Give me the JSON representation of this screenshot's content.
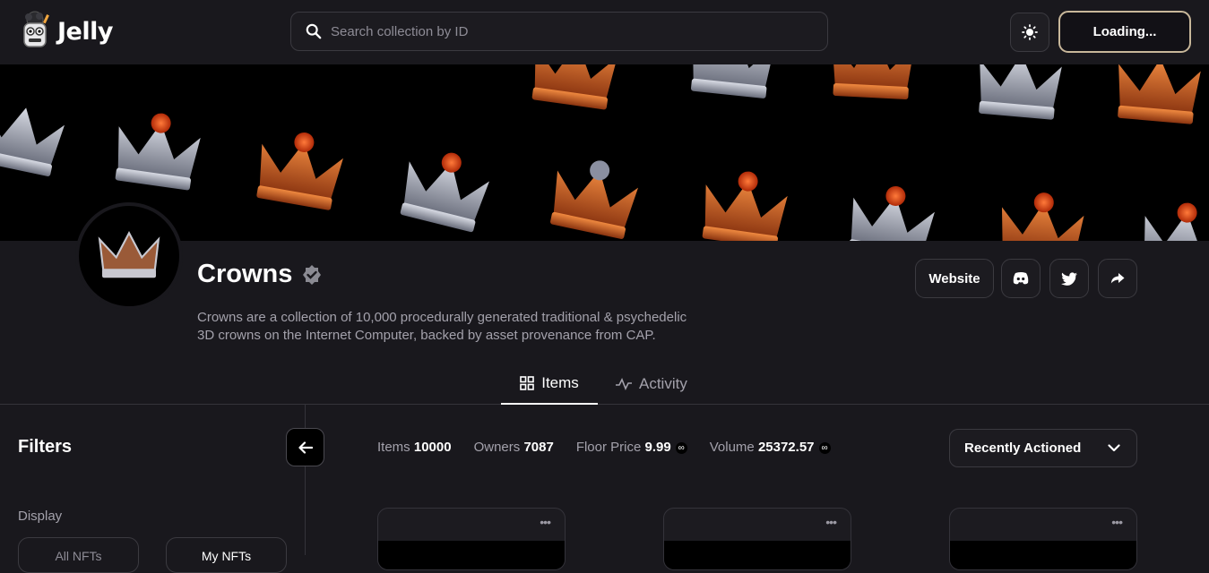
{
  "app": {
    "name": "Jelly"
  },
  "search": {
    "placeholder": "Search collection by ID"
  },
  "header": {
    "connect_label": "Loading..."
  },
  "collection": {
    "name": "Crowns",
    "verified": true,
    "description_line1": "Crowns are a collection of 10,000 procedurally generated traditional & psychedelic",
    "description_line2": "3D crowns on the Internet Computer, backed by asset provenance from CAP.",
    "links": {
      "website_label": "Website"
    }
  },
  "tabs": [
    {
      "label": "Items",
      "active": true
    },
    {
      "label": "Activity",
      "active": false
    }
  ],
  "filters": {
    "title": "Filters",
    "display_label": "Display",
    "display_options": [
      "All NFTs",
      "My NFTs"
    ]
  },
  "stats": {
    "items_label": "Items",
    "items_value": "10000",
    "owners_label": "Owners",
    "owners_value": "7087",
    "floor_label": "Floor Price",
    "floor_value": "9.99",
    "volume_label": "Volume",
    "volume_value": "25372.57"
  },
  "sort": {
    "selected": "Recently Actioned"
  },
  "cards": [
    {
      "menu": "•••"
    },
    {
      "menu": "•••"
    },
    {
      "menu": "•••"
    }
  ],
  "colors": {
    "background": "#19181d",
    "banner": "#000000",
    "accent_border": "#c8b79a",
    "orange": "#e86a2a",
    "silver": "#b8bcc8"
  }
}
